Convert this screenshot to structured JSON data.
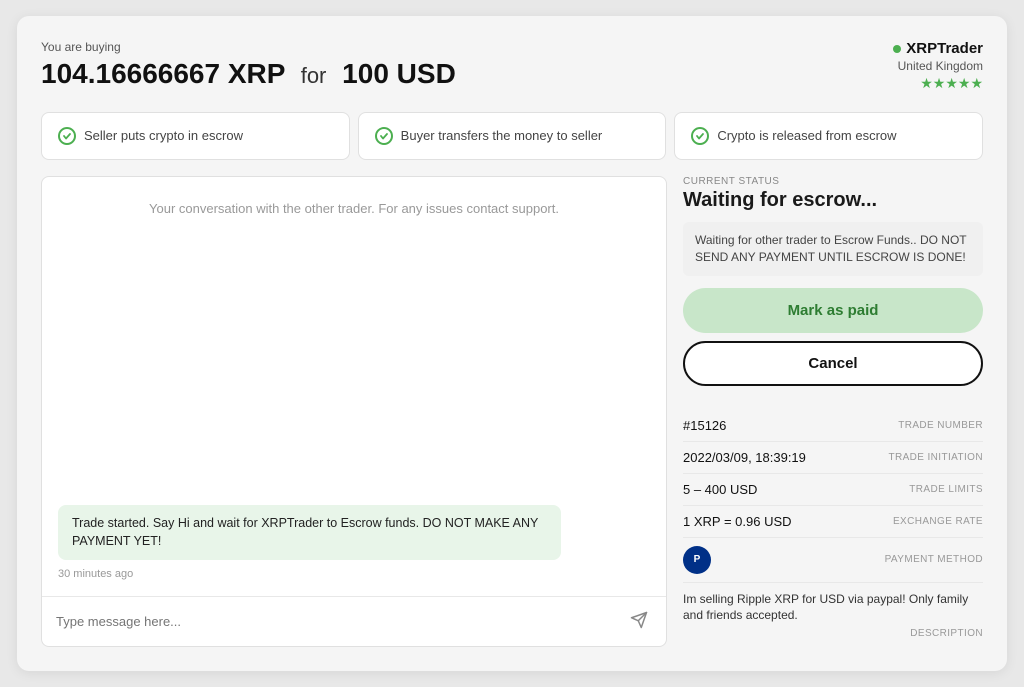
{
  "header": {
    "you_are_buying": "You are buying",
    "crypto_amount": "104.16666667 XRP",
    "for_text": "for",
    "fiat_amount": "100 USD"
  },
  "trader": {
    "name": "XRPTrader",
    "location": "United Kingdom",
    "stars": "★★★★★"
  },
  "steps": [
    {
      "label": "Seller puts crypto in escrow",
      "active": true
    },
    {
      "label": "Buyer transfers the money to seller",
      "active": true
    },
    {
      "label": "Crypto is released from escrow",
      "active": true
    }
  ],
  "chat": {
    "placeholder": "Your conversation with the other trader. For any issues contact support.",
    "message": "Trade started. Say Hi and wait for XRPTrader to Escrow funds. DO NOT MAKE ANY PAYMENT YET!",
    "message_time": "30 minutes ago",
    "input_placeholder": "Type message here..."
  },
  "status": {
    "current_status_label": "CURRENT STATUS",
    "title": "Waiting for escrow...",
    "notice": "Waiting for other trader to Escrow Funds.. DO NOT SEND ANY PAYMENT UNTIL ESCROW IS DONE!",
    "mark_paid_label": "Mark as paid",
    "cancel_label": "Cancel"
  },
  "trade_details": {
    "trade_number_value": "#15126",
    "trade_number_label": "TRADE NUMBER",
    "trade_initiation_value": "2022/03/09, 18:39:19",
    "trade_initiation_label": "TRADE INITIATION",
    "trade_limits_value": "5 – 400 USD",
    "trade_limits_label": "TRADE LIMITS",
    "exchange_rate_value": "1 XRP = 0.96 USD",
    "exchange_rate_label": "EXCHANGE RATE",
    "payment_method_label": "PAYMENT METHOD",
    "description_text": "Im selling Ripple XRP for USD via paypal! Only family and friends accepted.",
    "description_label": "DESCRIPTION"
  }
}
